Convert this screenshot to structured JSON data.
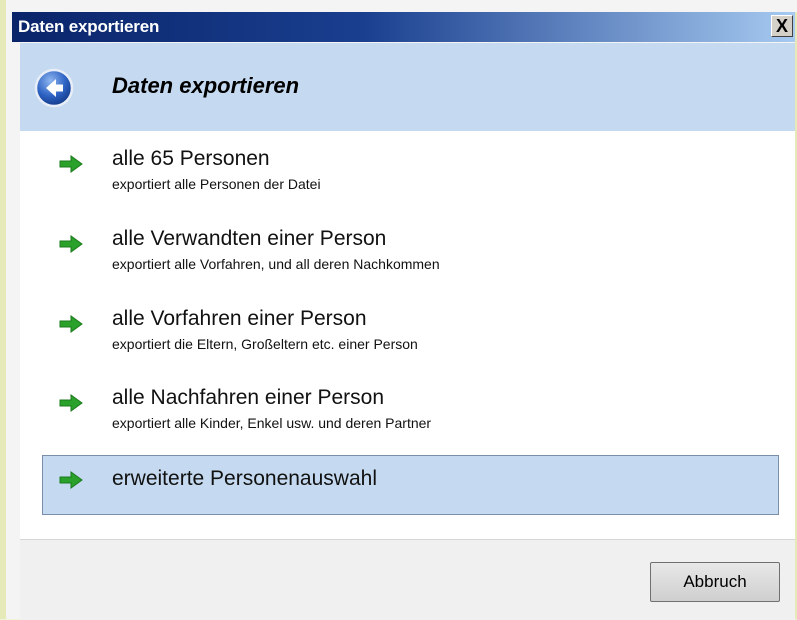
{
  "window": {
    "title": "Daten exportieren",
    "close_label": "X"
  },
  "header": {
    "title": "Daten exportieren",
    "back_icon": "back-arrow-icon"
  },
  "options": [
    {
      "label": "alle 65 Personen",
      "description": "exportiert alle Personen der Datei",
      "icon": "green-arrow-icon"
    },
    {
      "label": "alle Verwandten einer Person",
      "description": "exportiert alle Vorfahren, und all deren Nachkommen",
      "icon": "green-arrow-icon"
    },
    {
      "label": "alle Vorfahren einer Person",
      "description": "exportiert die Eltern, Großeltern etc. einer Person",
      "icon": "green-arrow-icon"
    },
    {
      "label": "alle Nachfahren einer Person",
      "description": "exportiert alle Kinder, Enkel usw. und deren Partner",
      "icon": "green-arrow-icon"
    },
    {
      "label": "erweiterte Personenauswahl",
      "description": "",
      "icon": "green-arrow-icon",
      "selected": true
    }
  ],
  "footer": {
    "cancel_label": "Abbruch"
  },
  "colors": {
    "title_bar_start": "#0a246a",
    "header_bg": "#c5daf0",
    "arrow_green": "#2aa12a",
    "selected_bg": "#c5daf0"
  }
}
